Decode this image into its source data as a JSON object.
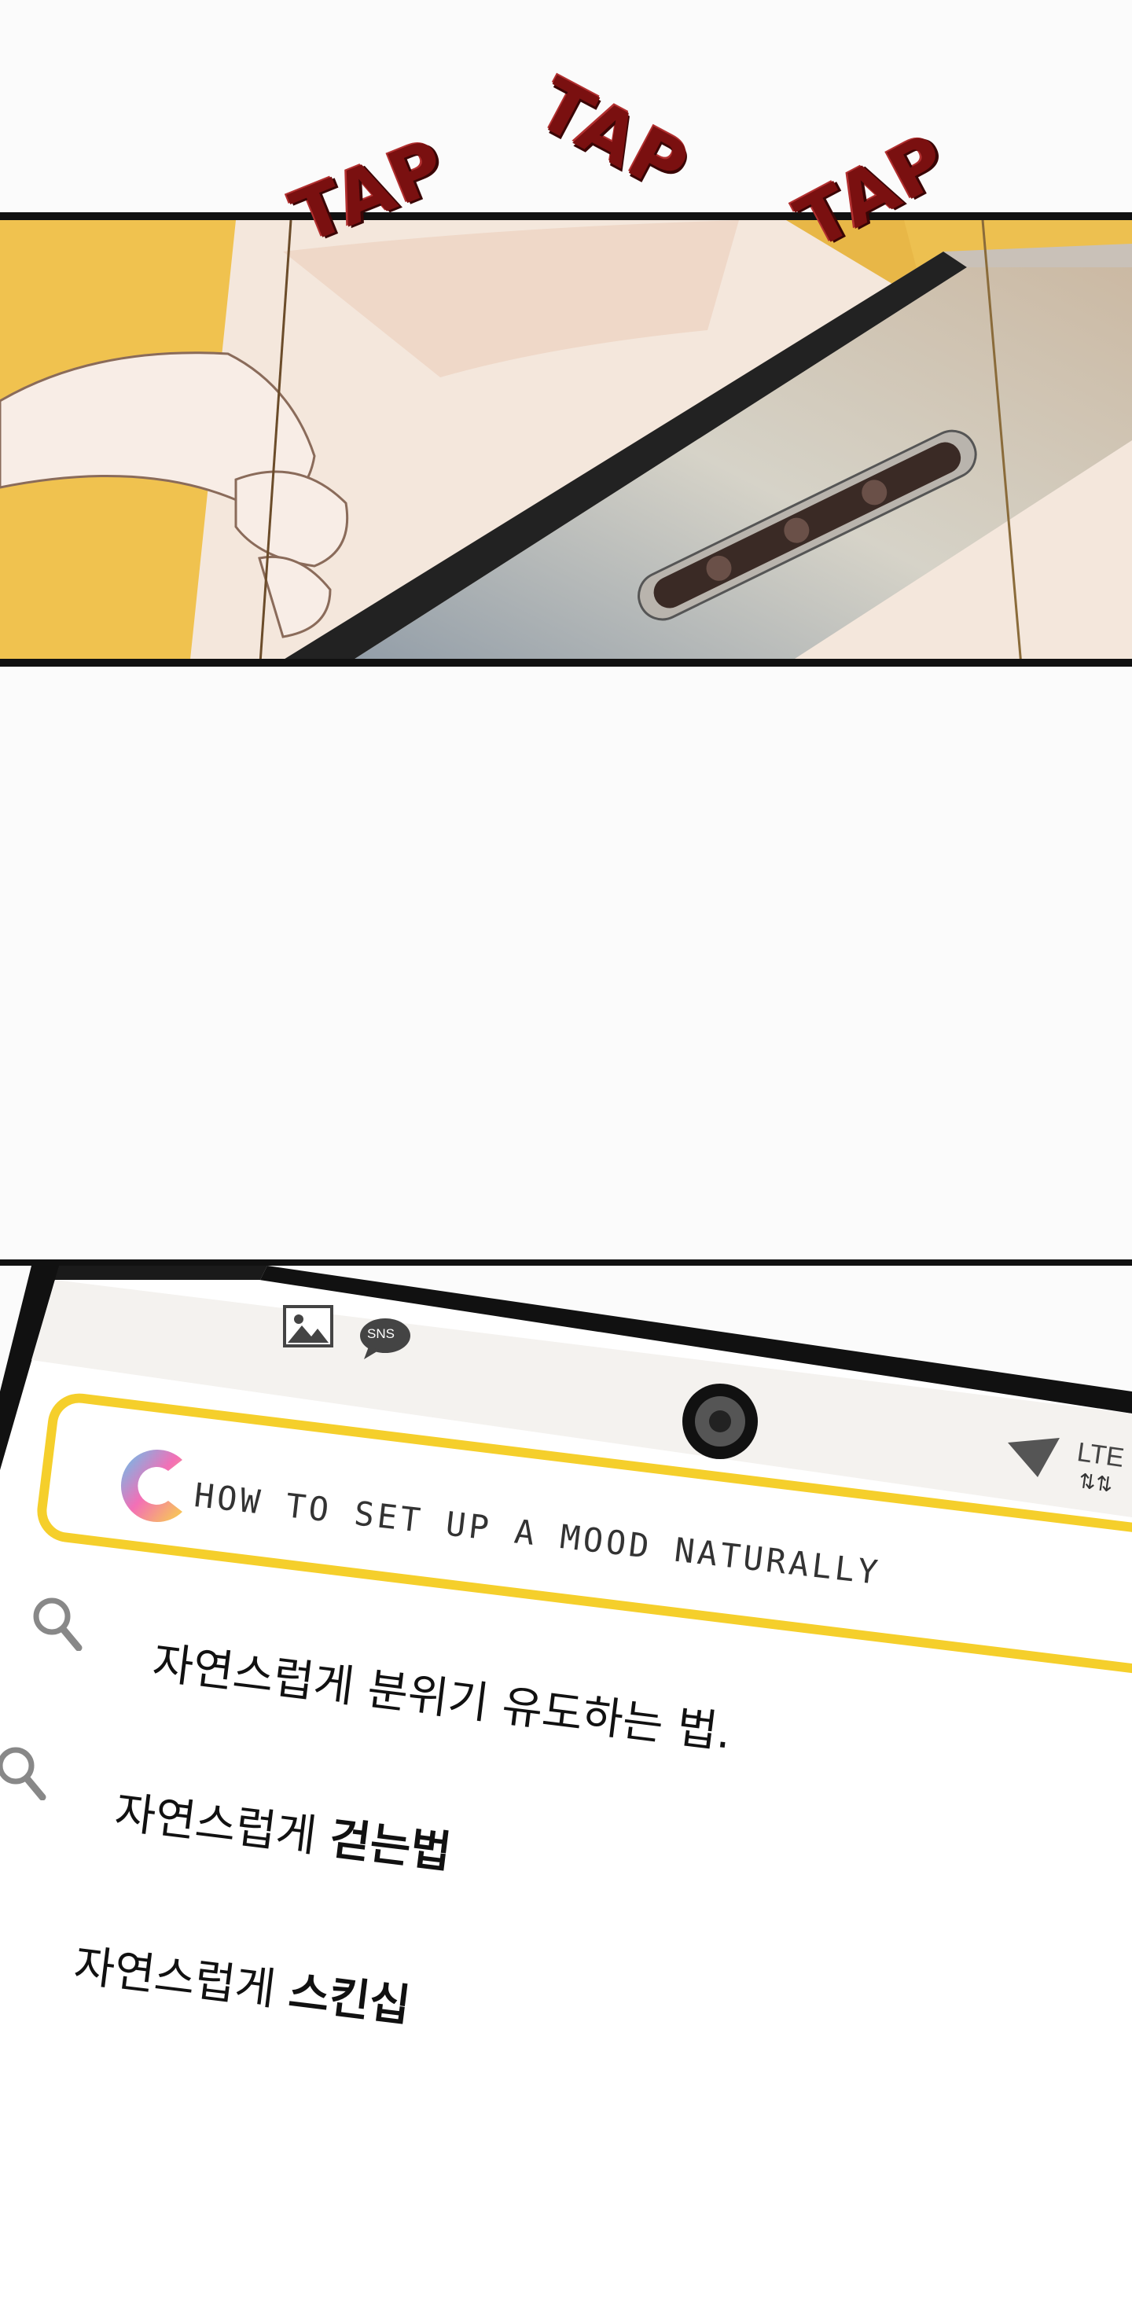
{
  "panel1": {
    "sfx": [
      "TAP",
      "TAP",
      "TAP"
    ]
  },
  "phone": {
    "status_icons": [
      "image-icon",
      "sns-icon",
      "camera-icon",
      "wifi-icon"
    ],
    "sns_label": "SNS",
    "network_label": "LTE",
    "app_logo": "C",
    "search_query": "HOW TO SET UP A MOOD NATURALLY",
    "suggestions": [
      {
        "prefix": "자연스럽게 분위기 유도하는 법.",
        "bold": ""
      },
      {
        "prefix": "자연스럽게 ",
        "bold": "걷는법"
      },
      {
        "prefix": "자연스럽게 ",
        "bold": "스킨십"
      }
    ]
  }
}
